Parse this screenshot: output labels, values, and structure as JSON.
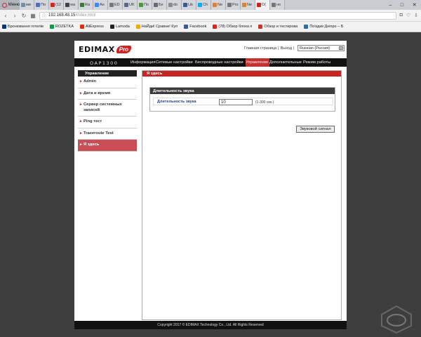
{
  "browser": {
    "menu_label": "Меню",
    "tabs": [
      {
        "label": "ми",
        "color": "#7a8ea8"
      },
      {
        "label": "По",
        "color": "#4a72b8"
      },
      {
        "label": "(12",
        "color": "#e02020"
      },
      {
        "label": "wa",
        "color": "#444444"
      },
      {
        "label": "Ra",
        "color": "#3a7d3a"
      },
      {
        "label": "Ан",
        "color": "#4285f4"
      },
      {
        "label": "ED",
        "color": "#777777"
      },
      {
        "label": "UK",
        "color": "#5a6a88"
      },
      {
        "label": "По",
        "color": "#4a9a3a"
      },
      {
        "label": "Бе",
        "color": "#6a6a6a"
      },
      {
        "label": "do",
        "color": "#8a8a8a"
      },
      {
        "label": "Lik",
        "color": "#3b5998"
      },
      {
        "label": "Ch",
        "color": "#00aff0"
      },
      {
        "label": "Ne",
        "color": "#e08030"
      },
      {
        "label": "Pro",
        "color": "#777777"
      },
      {
        "label": "Ne",
        "color": "#e08030"
      },
      {
        "label": "O(",
        "color": "#d02020"
      },
      {
        "label": "но",
        "color": "#777777"
      }
    ],
    "active_tab_index": 16,
    "url_host": "192.168.48.15",
    "url_path": "/index.html",
    "bookmarks": [
      {
        "label": "Бронювання готелів",
        "color": "#003580"
      },
      {
        "label": "ROZETKA",
        "color": "#00a046"
      },
      {
        "label": "AliExpress",
        "color": "#e62e04"
      },
      {
        "label": "Lamoda",
        "color": "#222222"
      },
      {
        "label": "НаЙди! Сравни! Куп",
        "color": "#f2a900"
      },
      {
        "label": "Facebook",
        "color": "#3b5998"
      },
      {
        "label": "(78) Обзор блока п",
        "color": "#e02020"
      },
      {
        "label": "Обзор и тестирова",
        "color": "#cc3333"
      },
      {
        "label": "Поїздки Дніпро – Б",
        "color": "#2a6ab0"
      }
    ]
  },
  "router": {
    "brand": "EDIMAX",
    "brand_badge": "Pro",
    "top_links": {
      "home": "Главная страница",
      "separator": "|",
      "logout": "Выход",
      "separator2": "|"
    },
    "language": "Russian (Россия)",
    "model": "OAP1300",
    "nav": [
      {
        "label": "Информация",
        "width": 36
      },
      {
        "label": "Сетевые настройки",
        "width": 56
      },
      {
        "label": "Беспроводные настройки",
        "width": 72
      },
      {
        "label": "Управление",
        "width": 34
      },
      {
        "label": "Дополнительные",
        "width": 48
      },
      {
        "label": "Режим работы",
        "width": 42
      }
    ],
    "nav_active_index": 3,
    "sidebar": {
      "title": "Управление",
      "items": [
        "Admin",
        "Дата и время",
        "Сервер системных записей",
        "Ping тест",
        "Traceroute Test",
        "Я здесь"
      ],
      "active_index": 5
    },
    "content": {
      "title": "Я здесь",
      "panel_title": "Длительность звука",
      "field_label": "Длительность звука",
      "field_value": "10",
      "field_hint": "(1-300 сек.)",
      "button": "Звуковой сигнал"
    },
    "footer": "Copyright 2017 © EDIMAX Technology Co., Ltd. All Rights Reserved"
  }
}
